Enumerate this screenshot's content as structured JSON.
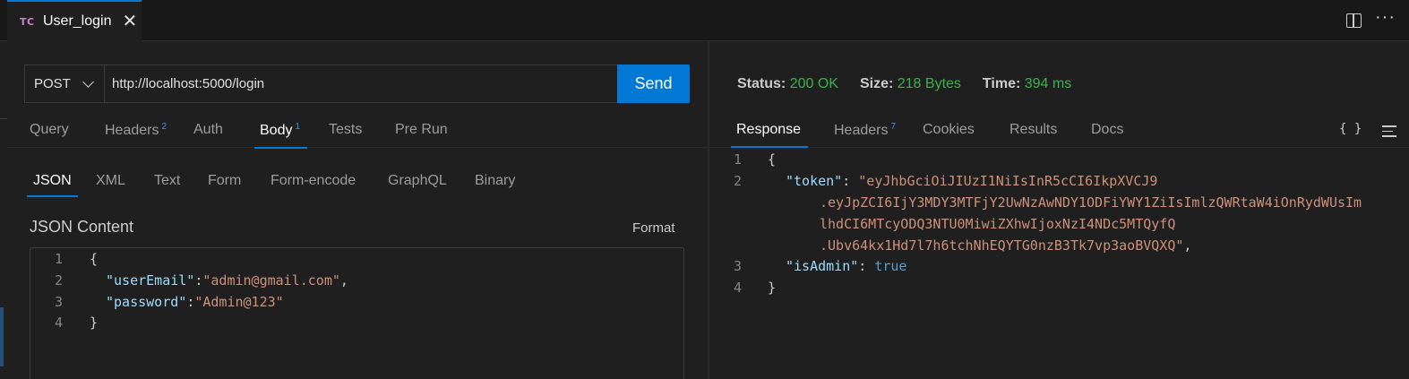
{
  "tab": {
    "badge": "TC",
    "title": "User_login",
    "close": "✕"
  },
  "request": {
    "method": "POST",
    "url": "http://localhost:5000/login",
    "send_label": "Send",
    "tabs": [
      {
        "label": "Query",
        "count": ""
      },
      {
        "label": "Headers",
        "count": "2"
      },
      {
        "label": "Auth",
        "count": ""
      },
      {
        "label": "Body",
        "count": "1"
      },
      {
        "label": "Tests",
        "count": ""
      },
      {
        "label": "Pre Run",
        "count": ""
      }
    ],
    "active_tab": "Body",
    "body_tabs": [
      "JSON",
      "XML",
      "Text",
      "Form",
      "Form-encode",
      "GraphQL",
      "Binary"
    ],
    "active_body_tab": "JSON",
    "json_content_label": "JSON Content",
    "format_label": "Format",
    "body_lines": [
      {
        "n": "1",
        "text": "{"
      },
      {
        "n": "2",
        "key": "\"userEmail\"",
        "sep": ":",
        "val": "\"admin@gmail.com\"",
        "end": ","
      },
      {
        "n": "3",
        "key": "\"password\"",
        "sep": ":",
        "val": "\"Admin@123\"",
        "end": ""
      },
      {
        "n": "4",
        "text": "}"
      }
    ]
  },
  "response": {
    "status_label": "Status:",
    "status_value": "200 OK",
    "size_label": "Size:",
    "size_value": "218 Bytes",
    "time_label": "Time:",
    "time_value": "394 ms",
    "tabs": [
      {
        "label": "Response",
        "count": ""
      },
      {
        "label": "Headers",
        "count": "7"
      },
      {
        "label": "Cookies",
        "count": ""
      },
      {
        "label": "Results",
        "count": ""
      },
      {
        "label": "Docs",
        "count": ""
      }
    ],
    "active_tab": "Response",
    "brace_icon": "{ }",
    "lines": {
      "l1": "{",
      "l2_key": "\"token\"",
      "l2_sep": ": ",
      "token_1": "\"eyJhbGciOiJIUzI1NiIsInR5cCI6IkpXVCJ9",
      "token_2": ".eyJpZCI6IjY3MDY3MTFjY2UwNzAwNDY1ODFiYWY1ZiIsImlzQWRtaW4iOnRydWUsIm",
      "token_3": "lhdCI6MTcyODQ3NTU0MiwiZXhwIjoxNzI4NDc5MTQyfQ",
      "token_4": ".Ubv64kx1Hd7l7h6tchNhEQYTG0nzB3Tk7vp3aoBVQXQ\"",
      "token_end": ",",
      "l3_key": "\"isAdmin\"",
      "l3_sep": ": ",
      "l3_val": "true",
      "l4": "}"
    },
    "line_numbers": [
      "1",
      "2",
      "3",
      "4"
    ]
  }
}
